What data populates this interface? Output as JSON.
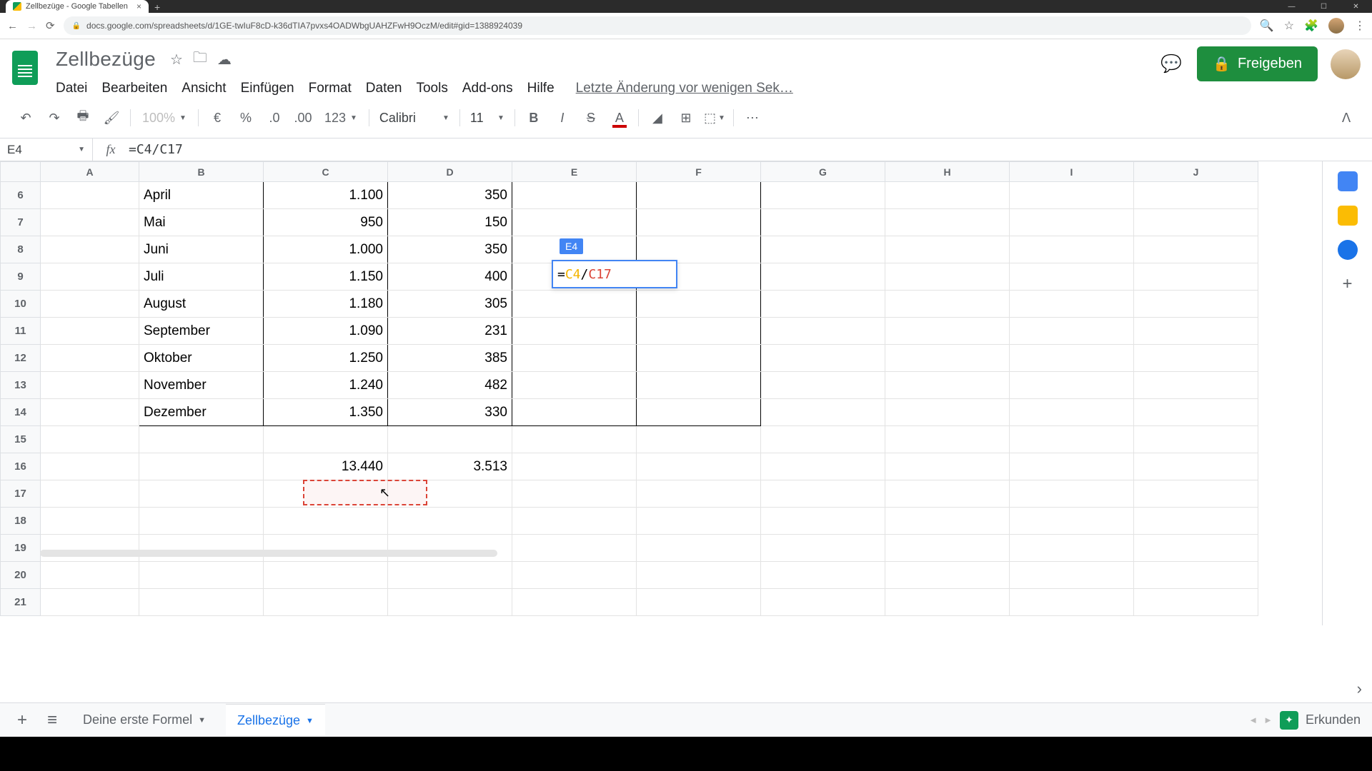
{
  "browser": {
    "tab_title": "Zellbezüge - Google Tabellen",
    "url": "docs.google.com/spreadsheets/d/1GE-twIuF8cD-k36dTIA7pvxs4OADWbgUAHZFwH9OczM/edit#gid=1388924039"
  },
  "header": {
    "doc_title": "Zellbezüge",
    "share_label": "Freigeben",
    "last_edit": "Letzte Änderung vor wenigen Sek…",
    "menus": [
      "Datei",
      "Bearbeiten",
      "Ansicht",
      "Einfügen",
      "Format",
      "Daten",
      "Tools",
      "Add-ons",
      "Hilfe"
    ]
  },
  "toolbar": {
    "zoom": "100%",
    "num_format": "123",
    "font": "Calibri",
    "font_size": "11"
  },
  "formula_bar": {
    "cell_ref": "E4",
    "formula": "=C4/C17"
  },
  "columns": [
    "A",
    "B",
    "C",
    "D",
    "E",
    "F",
    "G",
    "H",
    "I",
    "J"
  ],
  "rows": [
    {
      "n": 6,
      "b": "April",
      "c": "1.100",
      "d": "350"
    },
    {
      "n": 7,
      "b": "Mai",
      "c": "950",
      "d": "150"
    },
    {
      "n": 8,
      "b": "Juni",
      "c": "1.000",
      "d": "350"
    },
    {
      "n": 9,
      "b": "Juli",
      "c": "1.150",
      "d": "400"
    },
    {
      "n": 10,
      "b": "August",
      "c": "1.180",
      "d": "305"
    },
    {
      "n": 11,
      "b": "September",
      "c": "1.090",
      "d": "231"
    },
    {
      "n": 12,
      "b": "Oktober",
      "c": "1.250",
      "d": "385"
    },
    {
      "n": 13,
      "b": "November",
      "c": "1.240",
      "d": "482"
    },
    {
      "n": 14,
      "b": "Dezember",
      "c": "1.350",
      "d": "330"
    },
    {
      "n": 15,
      "b": "",
      "c": "",
      "d": ""
    },
    {
      "n": 16,
      "b": "",
      "c": "13.440",
      "d": "3.513"
    },
    {
      "n": 17,
      "b": "",
      "c": "",
      "d": ""
    },
    {
      "n": 18,
      "b": "",
      "c": "",
      "d": ""
    },
    {
      "n": 19,
      "b": "",
      "c": "",
      "d": ""
    },
    {
      "n": 20,
      "b": "",
      "c": "",
      "d": ""
    },
    {
      "n": 21,
      "b": "",
      "c": "",
      "d": ""
    }
  ],
  "editing": {
    "label": "E4",
    "eq": "=",
    "ref1": "C4",
    "slash": "/",
    "ref2": "C17"
  },
  "sheet_tabs": {
    "tab1": "Deine erste Formel",
    "tab2": "Zellbezüge",
    "explore": "Erkunden"
  }
}
